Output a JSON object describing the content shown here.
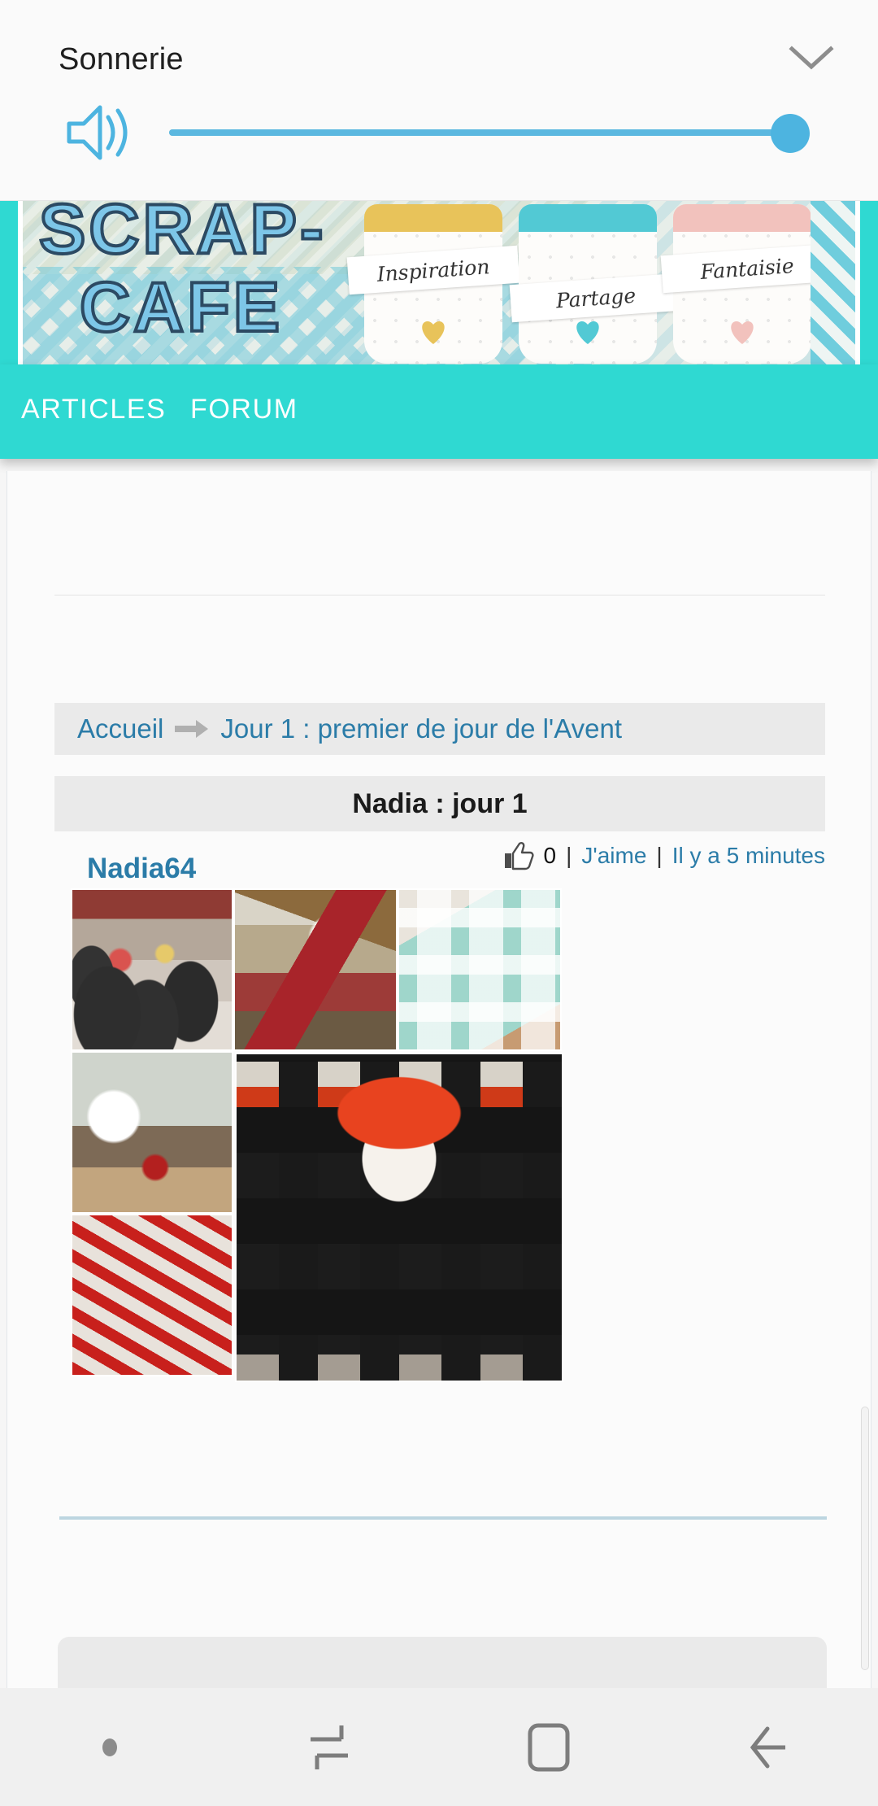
{
  "volume_panel": {
    "title": "Sonnerie",
    "collapse_icon": "chevron-down-icon",
    "speaker_icon": "volume-high-icon",
    "slider": {
      "value": 100,
      "min": 0,
      "max": 100,
      "accent_color": "#4db4e0"
    }
  },
  "banner": {
    "site_name_line1": "SCRAP-",
    "site_name_line2": "CAFE",
    "jars": [
      {
        "label": "Inspiration",
        "accent": "#e8c35a",
        "heart": "#e8c35a"
      },
      {
        "label": "Partage",
        "accent": "#52c9d4",
        "heart": "#52c9d4"
      },
      {
        "label": "Fantaisie",
        "accent": "#f2c2bd",
        "heart": "#f2c2bd"
      }
    ]
  },
  "nav": {
    "background": "#2fd9d2",
    "items": [
      {
        "label": "ARTICLES"
      },
      {
        "label": "FORUM"
      }
    ]
  },
  "breadcrumb": {
    "home": "Accueil",
    "separator_icon": "arrow-right-icon",
    "current": "Jour 1 : premier de jour de l'Avent",
    "link_color": "#2b7ca8"
  },
  "post": {
    "title": "Nadia : jour 1",
    "author": "Nadia64",
    "like_icon": "thumbs-up-icon",
    "like_count": "0",
    "sep1": "|",
    "like_label": "J'aime",
    "sep2": "|",
    "timestamp": "Il y a 5 minutes"
  },
  "gallery": {
    "photos": [
      {
        "alt": "Mugs de Noël remplis de friandises",
        "style": "mugs"
      },
      {
        "alt": "Boîte de pochettes cadeaux en papier",
        "style": "gifts"
      },
      {
        "alt": "Calendrier de l'Avent mural avec étoiles",
        "style": "calendar"
      },
      {
        "alt": "Sapin blanc et décorations sur une table",
        "style": "tree"
      },
      {
        "alt": "Guirlande rouge en étoiles sur un escalier",
        "style": "stairs"
      },
      {
        "alt": "Calendrier de l'Avent Père Noël à pochettes numérotées",
        "style": "santa"
      }
    ]
  },
  "system_nav": {
    "items": [
      {
        "icon": "dot-indicator-icon",
        "label": ""
      },
      {
        "icon": "recents-icon",
        "label": ""
      },
      {
        "icon": "home-icon",
        "label": ""
      },
      {
        "icon": "back-arrow-icon",
        "label": ""
      }
    ]
  }
}
